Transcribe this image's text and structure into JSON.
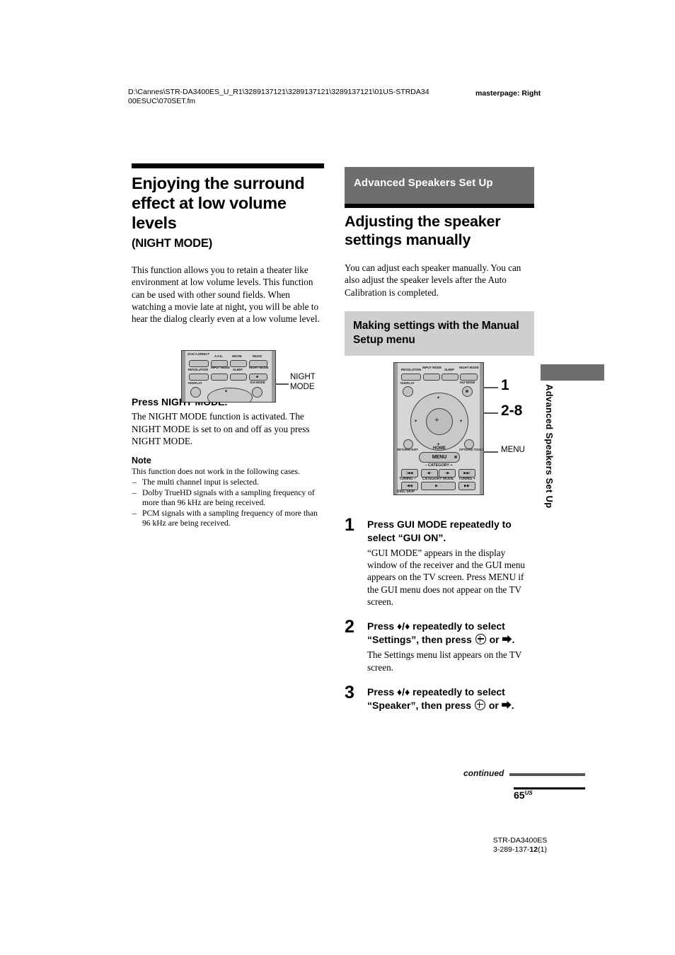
{
  "header": {
    "path": "D:\\Cannes\\STR-DA3400ES_U_R1\\3289137121\\3289137121\\3289137121\\01US-STRDA3400ESUC\\070SET.fm",
    "masterpage": "masterpage: Right"
  },
  "left_column": {
    "chapter_title": "Enjoying the surround effect at low volume levels",
    "chapter_subtitle": "(NIGHT MODE)",
    "intro": "This function allows you to retain a theater like environment at low volume levels. This function can be used with other sound fields. When watching a movie late at night, you will be able to hear the dialog clearly even at a low volume level.",
    "remote_callout": "NIGHT MODE",
    "instruction_heading": "Press NIGHT MODE.",
    "instruction_body": "The NIGHT MODE function is activated. The NIGHT MODE is set to on and off as you press NIGHT MODE.",
    "note_heading": "Note",
    "note_intro": "This function does not work in the following cases.",
    "note_items": [
      "The multi channel input is selected.",
      "Dolby TrueHD signals with a sampling frequency of more than 96 kHz are being received.",
      "PCM signals with a sampling frequency of more than 96 kHz are being received."
    ],
    "remote_buttons": {
      "row1": [
        "2CH/ A.DIRECT",
        "A.F.D.",
        "MOVIE",
        "MUSIC"
      ],
      "row2": [
        "RESOLUTION",
        "INPUT MODE",
        "SLEEP",
        "NIGHT MODE"
      ],
      "display": "+DISPLAY",
      "gui": "GUI MODE"
    }
  },
  "right_column": {
    "banner": "Advanced Speakers Set Up",
    "section_title": "Adjusting the speaker settings manually",
    "intro": "You can adjust each speaker manually. You can also adjust the speaker levels after the Auto Calibration is completed.",
    "subsection_title": "Making settings with the Manual Setup menu",
    "callouts": {
      "one": "1",
      "range": "2-8",
      "menu": "MENU"
    },
    "remote_labels": {
      "resolution": "RESOLUTION",
      "input_mode": "INPUT MODE",
      "sleep": "SLEEP",
      "night_mode": "NIGHT MODE",
      "display": "+DISPLAY",
      "gui_mode": "GUI MODE",
      "return_exit": "RETURN/ EXIT",
      "home": "HOME",
      "menu": "MENU",
      "options_tools": "OPTIONS TOOLS",
      "category": "CATEGORY",
      "category_mode": "CATEGORY MODE",
      "tuning_minus": "TUNING",
      "tuning_plus": "TUNING",
      "disc_skip": "DISC SKIP"
    },
    "steps": [
      {
        "num": "1",
        "title": "Press GUI MODE repeatedly to select “GUI ON”.",
        "desc": "“GUI MODE” appears in the display window of the receiver and the GUI menu appears on the TV screen. Press MENU if the GUI menu does not appear on the TV screen."
      },
      {
        "num": "2",
        "title_pre": "Press ♦/♦ repeatedly to select “Settings”, then press",
        "title_post": "or ⮕.",
        "desc": "The Settings menu list appears on the TV screen."
      },
      {
        "num": "3",
        "title_pre": "Press ♦/♦ repeatedly to select “Speaker”, then press",
        "title_post": "or ⮕.",
        "desc": ""
      }
    ],
    "side_tab": "Advanced Speakers Set Up"
  },
  "footer": {
    "continued": "continued",
    "page_number": "65",
    "page_suffix": "US",
    "model": "STR-DA3400ES",
    "part_pre": "3-289-137-",
    "part_bold": "12",
    "part_post": "(1)"
  }
}
